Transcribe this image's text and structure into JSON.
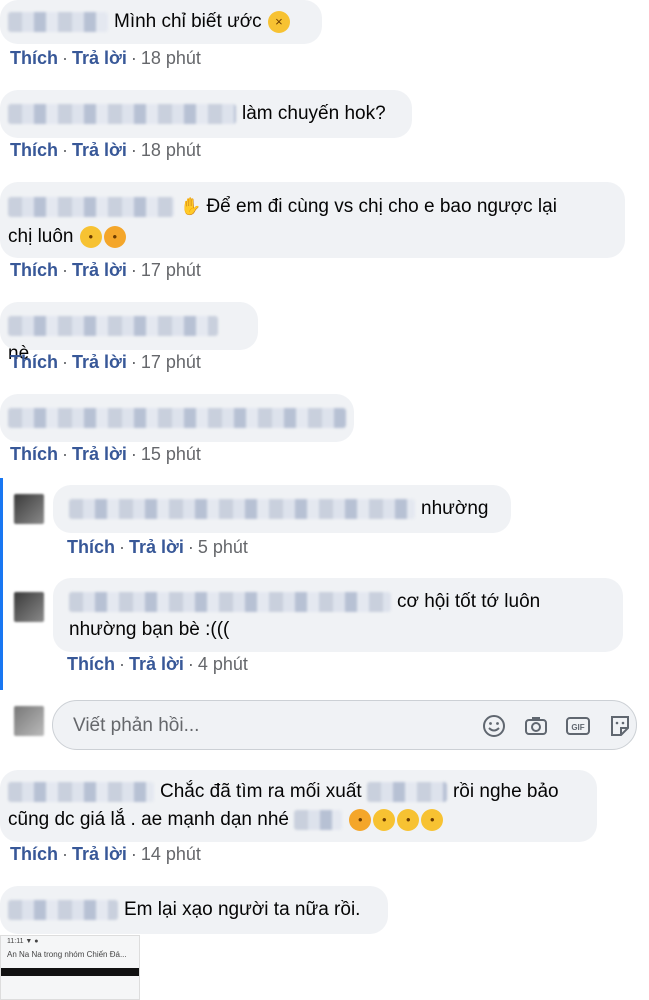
{
  "actions": {
    "like": "Thích",
    "reply": "Trả lời",
    "separator": "·"
  },
  "comments": [
    {
      "text": "Mình chỉ biết ước",
      "time": "18 phút"
    },
    {
      "text": "làm chuyến hok?",
      "time": "18 phút"
    },
    {
      "line1": "Để em đi cùng vs chị cho e bao ngược lại",
      "line2": "chị luôn",
      "time": "17 phút"
    },
    {
      "text": "nè",
      "time": "17 phút"
    },
    {
      "text": "",
      "time": "15 phút"
    }
  ],
  "replies": [
    {
      "text": "nhường",
      "time": "5 phút"
    },
    {
      "line1": "cơ hội tốt tớ luôn",
      "line2": "nhường bạn bè :(((",
      "time": "4 phút"
    }
  ],
  "reply_box": {
    "placeholder": "Viết phản hồi...",
    "icons": [
      "smiley-icon",
      "camera-icon",
      "gif-icon",
      "sticker-icon"
    ]
  },
  "comments_after": [
    {
      "line1a": "Chắc đã tìm ra mối xuất",
      "line1b": "rồi nghe bảo",
      "line2": "cũng dc giá lắ . ae mạnh dạn nhé",
      "time": "14 phút"
    },
    {
      "text": "Em lại xạo người ta nữa rồi."
    }
  ],
  "thumbnail": {
    "top": "11:11 ▼ ●",
    "caption": "An Na Na trong nhóm Chiến Đá..."
  },
  "colors": {
    "link": "#385898",
    "bubble": "#f0f2f5",
    "meta": "#65676b",
    "thread": "#1877f2"
  }
}
